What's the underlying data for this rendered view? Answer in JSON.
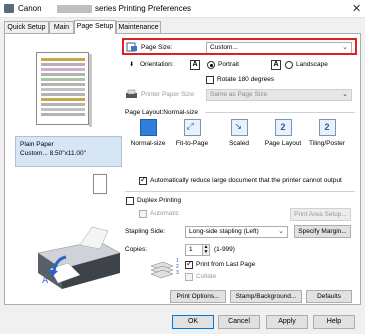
{
  "window": {
    "title_prefix": "Canon",
    "title_suffix": "series Printing Preferences",
    "close_glyph": "✕"
  },
  "tabs": [
    {
      "label": "Quick Setup"
    },
    {
      "label": "Main"
    },
    {
      "label": "Page Setup"
    },
    {
      "label": "Maintenance"
    }
  ],
  "page_size": {
    "label": "Page Size:",
    "value": "Custom..."
  },
  "orientation": {
    "label": "Orientation:",
    "portrait": "Portrait",
    "landscape": "Landscape",
    "selected": "Portrait"
  },
  "rotate": {
    "label": "Rotate 180 degrees"
  },
  "printer_paper_size": {
    "label": "Printer Paper Size:",
    "value": "Same as Page Size"
  },
  "page_layout": {
    "label": "Page Layout:Normal-size",
    "items": [
      "Normal-size",
      "Fit-to-Page",
      "Scaled",
      "Page Layout",
      "Tiling/Poster"
    ],
    "selected": "Normal-size"
  },
  "paper_info": {
    "line1": "Plain Paper",
    "line2": "Custom... 8.50\"x11.00\""
  },
  "auto_reduce": {
    "label": "Automatically reduce large document that the printer cannot output",
    "checked": true
  },
  "duplex": {
    "label": "Duplex Printing",
    "checked": false
  },
  "automatic": {
    "label": "Automatic"
  },
  "print_area_setup": {
    "label": "Print Area Setup..."
  },
  "stapling": {
    "label": "Stapling Side:",
    "value": "Long-side stapling (Left)"
  },
  "specify_margin": {
    "label": "Specify Margin..."
  },
  "copies": {
    "label": "Copies:",
    "value": "1",
    "range": "(1-999)"
  },
  "print_from_last": {
    "label": "Print from Last Page",
    "checked": true
  },
  "collate": {
    "label": "Collate"
  },
  "buttons": {
    "print_options": "Print Options...",
    "stamp_background": "Stamp/Background...",
    "defaults": "Defaults",
    "ok": "OK",
    "cancel": "Cancel",
    "apply": "Apply",
    "help": "Help"
  },
  "colors": {
    "highlight": "#e02020",
    "selected_layout": "#2f7fd8",
    "paper_info_bg": "#d6e6f5"
  },
  "icons": [
    "page-size-icon",
    "orientation-a-icon",
    "printer-icon",
    "layout-icons",
    "copies-icon",
    "collate-icon"
  ]
}
